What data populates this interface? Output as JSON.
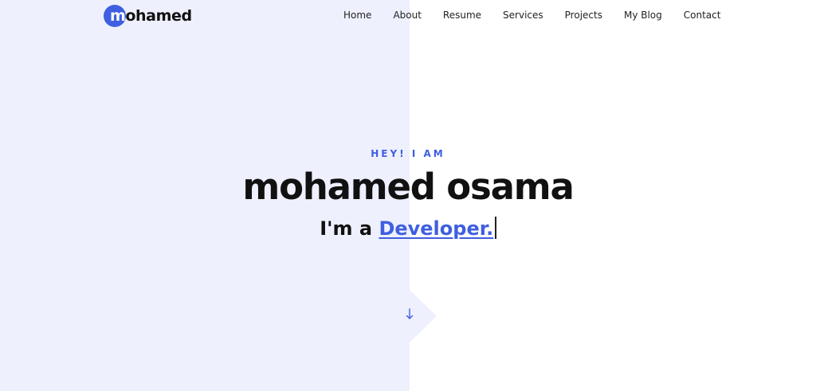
{
  "brand": {
    "logo_first_letter": "m",
    "logo_rest": "ohamed",
    "accent_color": "#3f5fe0"
  },
  "nav": {
    "items": [
      {
        "label": "Home"
      },
      {
        "label": "About"
      },
      {
        "label": "Resume"
      },
      {
        "label": "Services"
      },
      {
        "label": "Projects"
      },
      {
        "label": "My Blog"
      },
      {
        "label": "Contact"
      }
    ]
  },
  "hero": {
    "eyebrow": "HEY! I AM",
    "name": "mohamed osama",
    "intro_prefix": "I'm a",
    "role": "Developer.",
    "scroll_icon": "arrow-down-icon"
  }
}
